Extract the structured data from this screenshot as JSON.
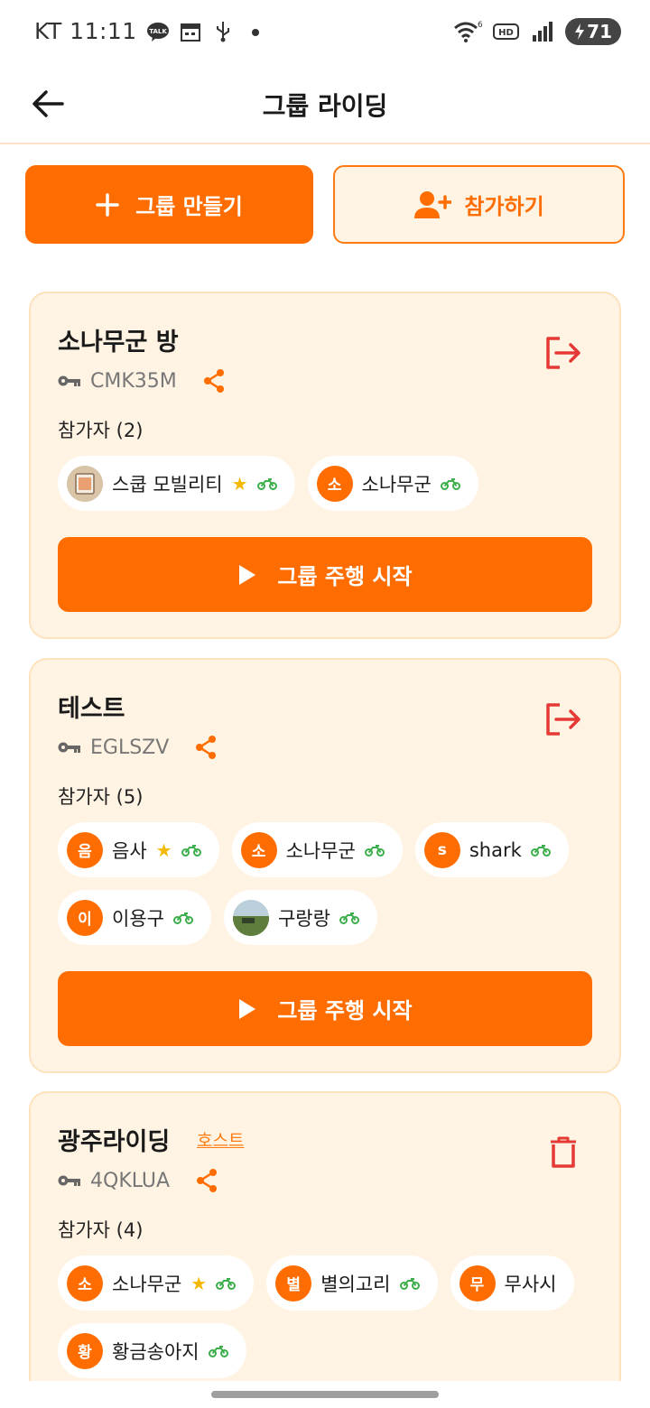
{
  "status_bar": {
    "carrier_time": "KT 11:11",
    "battery": "71",
    "icons": [
      "talk-icon",
      "calendar-icon",
      "usb-icon",
      "dot-icon",
      "wifi-icon",
      "hd-icon",
      "signal-icon",
      "battery-icon"
    ]
  },
  "app_bar": {
    "title": "그룹 라이딩"
  },
  "actions": {
    "create_label": "그룹 만들기",
    "join_label": "참가하기"
  },
  "colors": {
    "accent": "#ff6d00",
    "card_bg": "#fff3e3",
    "danger": "#e53935",
    "moto": "#3cae4b",
    "star": "#f5b800"
  },
  "groups": [
    {
      "title": "소나무군 방",
      "code": "CMK35M",
      "participants_label": "참가자 (2)",
      "action_icon": "exit-icon",
      "members": [
        {
          "name": "스쿱 모빌리티",
          "avatar": "",
          "leader": true
        },
        {
          "name": "소나무군",
          "avatar": "소",
          "leader": false
        }
      ],
      "start_label": "그룹 주행 시작"
    },
    {
      "title": "테스트",
      "code": "EGLSZV",
      "participants_label": "참가자 (5)",
      "action_icon": "exit-icon",
      "members": [
        {
          "name": "음사",
          "avatar": "음",
          "leader": true
        },
        {
          "name": "소나무군",
          "avatar": "소",
          "leader": false
        },
        {
          "name": "shark",
          "avatar": "s",
          "leader": false
        },
        {
          "name": "이용구",
          "avatar": "이",
          "leader": false
        },
        {
          "name": "구랑랑",
          "avatar": "",
          "leader": false
        }
      ],
      "start_label": "그룹 주행 시작"
    },
    {
      "title": "광주라이딩",
      "host_badge": "호스트",
      "code": "4QKLUA",
      "participants_label": "참가자 (4)",
      "action_icon": "trash-icon",
      "members": [
        {
          "name": "소나무군",
          "avatar": "소",
          "leader": true
        },
        {
          "name": "별의고리",
          "avatar": "별",
          "leader": false
        },
        {
          "name": "무사시",
          "avatar": "무",
          "leader": false
        },
        {
          "name": "황금송아지",
          "avatar": "황",
          "leader": false
        }
      ]
    }
  ]
}
